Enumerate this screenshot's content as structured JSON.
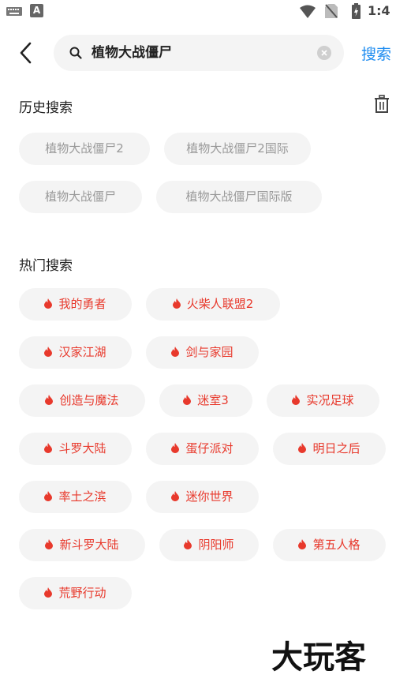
{
  "status_bar": {
    "time": "1:4",
    "notification_letter": "A"
  },
  "search": {
    "query": "植物大战僵尸",
    "button_label": "搜索"
  },
  "history": {
    "title": "历史搜索",
    "items": [
      "植物大战僵尸2",
      "植物大战僵尸2国际",
      "植物大战僵尸",
      "植物大战僵尸国际版"
    ]
  },
  "hot": {
    "title": "热门搜索",
    "items": [
      "我的勇者",
      "火柴人联盟2",
      "汉家江湖",
      "剑与家园",
      "创造与魔法",
      "迷室3",
      "实况足球",
      "斗罗大陆",
      "蛋仔派对",
      "明日之后",
      "率土之滨",
      "迷你世界",
      "新斗罗大陆",
      "阴阳师",
      "第五人格",
      "荒野行动"
    ]
  },
  "colors": {
    "accent_blue": "#1e8cf0",
    "hot_red": "#e8392c",
    "chip_bg": "#f4f4f4",
    "history_text": "#999999"
  },
  "watermark": {
    "text": "大玩客"
  }
}
